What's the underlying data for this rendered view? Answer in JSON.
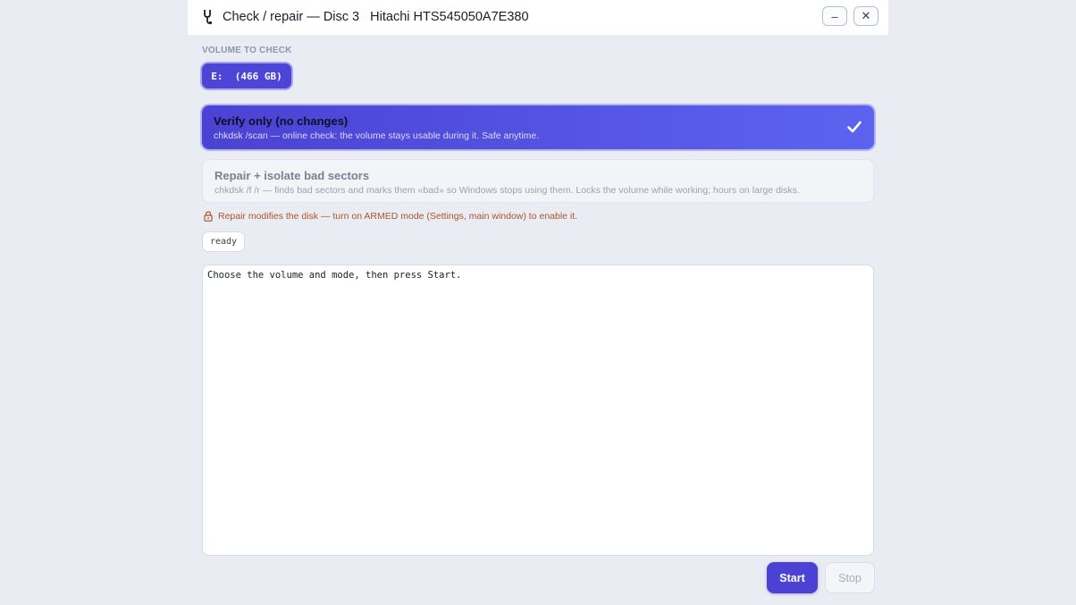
{
  "titlebar": {
    "title": "Check / repair — Disc 3   Hitachi HTS545050A7E380",
    "minimize_label": "–",
    "close_label": "✕"
  },
  "volume": {
    "section_label": "VOLUME TO CHECK",
    "selected": "E:  (466 GB)"
  },
  "modes": [
    {
      "title": "Verify only (no changes)",
      "description": "chkdsk /scan — online check: the volume stays usable during it. Safe anytime.",
      "selected": true
    },
    {
      "title": "Repair + isolate bad sectors",
      "description": "chkdsk /f /r — finds bad sectors and marks them «bad» so Windows stops using them. Locks the volume while working; hours on large disks.",
      "selected": false
    }
  ],
  "warning": {
    "icon": "lock-icon",
    "text": "Repair modifies the disk — turn on ARMED mode (Settings, main window) to enable it."
  },
  "status": "ready",
  "log": {
    "text": "Choose the volume and mode, then press Start."
  },
  "actions": {
    "start_label": "Start",
    "stop_label": "Stop"
  },
  "colors": {
    "accent": "#4b42d4",
    "warning": "#b0532b",
    "background": "#e9ecf2"
  }
}
